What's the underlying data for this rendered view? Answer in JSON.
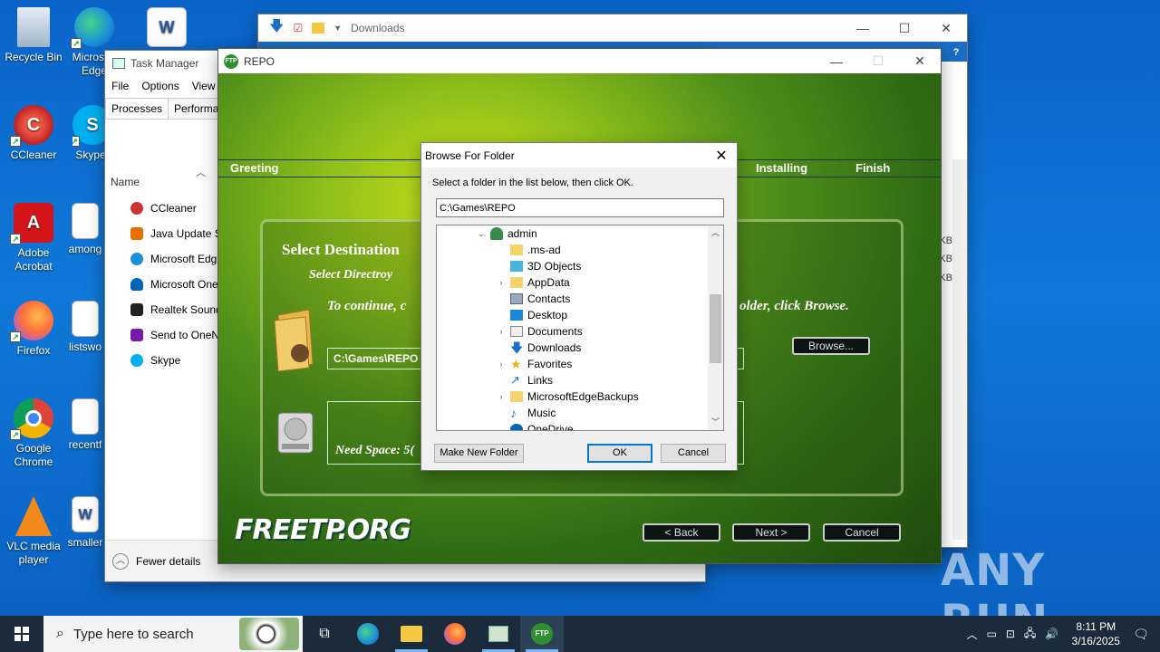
{
  "desktop": {
    "icons": [
      {
        "label": "Recycle Bin"
      },
      {
        "label": "Microsoft Edge"
      },
      {
        "label": "CCleaner"
      },
      {
        "label": "Skype"
      },
      {
        "label": "Adobe Acrobat"
      },
      {
        "label": "among"
      },
      {
        "label": "Firefox"
      },
      {
        "label": "listswo"
      },
      {
        "label": "Google Chrome"
      },
      {
        "label": "recentf"
      },
      {
        "label": "VLC media player"
      },
      {
        "label": "smaller"
      }
    ]
  },
  "explorer": {
    "title": "Downloads",
    "sizes": [
      "KB",
      "KB",
      "KB"
    ]
  },
  "taskmgr": {
    "title": "Task Manager",
    "menu": [
      "File",
      "Options",
      "View"
    ],
    "tabs": [
      "Processes",
      "Performan"
    ],
    "col_name": "Name",
    "rows": [
      "CCleaner",
      "Java Update Sc",
      "Microsoft Edg",
      "Microsoft One",
      "Realtek Sound",
      "Send to OneN",
      "Skype"
    ],
    "footer": "Fewer details"
  },
  "installer": {
    "title": "REPO",
    "steps": [
      "Greeting",
      "Installing",
      "Finish"
    ],
    "heading": "Select Destination",
    "subheading": "Select Directroy",
    "instr_left": "To continue, c",
    "instr_right": "older, click Browse.",
    "path": "C:\\Games\\REPO",
    "need_space": "Need Space: 5(",
    "browse": "Browse...",
    "back": "< Back",
    "next": "Next >",
    "cancel": "Cancel",
    "brand": "FREETP.ORG"
  },
  "browse_dialog": {
    "title": "Browse For Folder",
    "instruction": "Select a folder in the list below, then click OK.",
    "path": "C:\\Games\\REPO",
    "tree": [
      {
        "label": "admin",
        "level": 0,
        "expanded": true
      },
      {
        "label": ".ms-ad",
        "level": 1
      },
      {
        "label": "3D Objects",
        "level": 1
      },
      {
        "label": "AppData",
        "level": 1,
        "expandable": true
      },
      {
        "label": "Contacts",
        "level": 1
      },
      {
        "label": "Desktop",
        "level": 1
      },
      {
        "label": "Documents",
        "level": 1,
        "expandable": true
      },
      {
        "label": "Downloads",
        "level": 1
      },
      {
        "label": "Favorites",
        "level": 1,
        "expandable": true
      },
      {
        "label": "Links",
        "level": 1
      },
      {
        "label": "MicrosoftEdgeBackups",
        "level": 1,
        "expandable": true
      },
      {
        "label": "Music",
        "level": 1
      },
      {
        "label": "OneDrive",
        "level": 1
      }
    ],
    "make_new_folder": "Make New Folder",
    "ok": "OK",
    "cancel": "Cancel"
  },
  "taskbar": {
    "search_placeholder": "Type here to search",
    "time": "8:11 PM",
    "date": "3/16/2025"
  },
  "watermark": "ANY RUN"
}
